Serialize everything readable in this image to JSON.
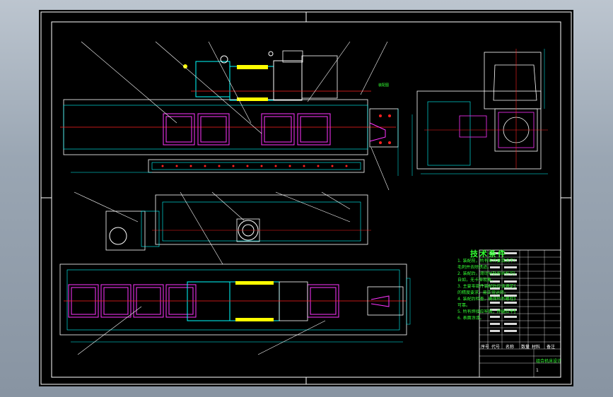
{
  "drawing": {
    "notes_title": "技术条件",
    "notes": [
      "1. 装配前，所有零件要清洗干净，去",
      "   毛刺并去除锈迹。",
      "2. 装配后，滑动导轨和丝杆可以手动",
      "   自如，无卡滞现象。",
      "3. 主要零部件装配后应该满足各自",
      "   的精度要求，能正常运转。",
      "4. 装配后检查，确保所有螺栓紧固",
      "   可靠。",
      "5. 所有焊接应牢固，焊缝应平整。",
      "6. 表面涂漆。"
    ],
    "title_block": {
      "col_headers": [
        "序号",
        "代号",
        "名称",
        "数量",
        "材料",
        "备注"
      ],
      "design_name": "组合机床设计",
      "sheet": "1"
    }
  },
  "colors": {
    "background": "#000000",
    "window_bg": "#9aa6b3",
    "lines_white": "#ffffff",
    "lines_cyan": "#00ffff",
    "lines_yellow": "#ffff00",
    "lines_red": "#ff2020",
    "lines_green": "#33ff33",
    "lines_magenta": "#ff33ff",
    "lines_blue": "#5555ff"
  }
}
